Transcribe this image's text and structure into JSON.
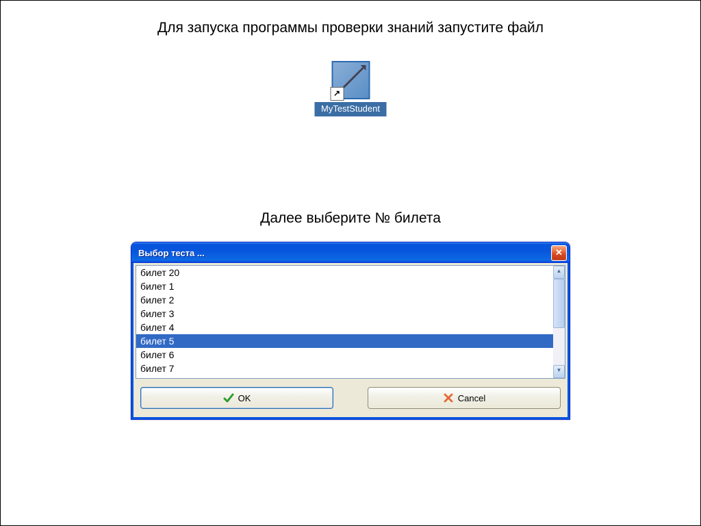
{
  "instructions": {
    "line1": "Для запуска программы проверки знаний запустите файл",
    "line2": "Далее выберите № билета"
  },
  "shortcut": {
    "label": "MyTestStudent",
    "arrow_glyph": "↗"
  },
  "dialog": {
    "title": "Выбор теста ...",
    "close_glyph": "✕",
    "items": [
      "билет 20",
      "билет 1",
      "билет 2",
      "билет 3",
      "билет 4",
      "билет 5",
      "билет 6",
      "билет 7"
    ],
    "selected_index": 5,
    "buttons": {
      "ok": "OK",
      "cancel": "Cancel"
    },
    "scroll": {
      "up_glyph": "▲",
      "down_glyph": "▼"
    }
  }
}
